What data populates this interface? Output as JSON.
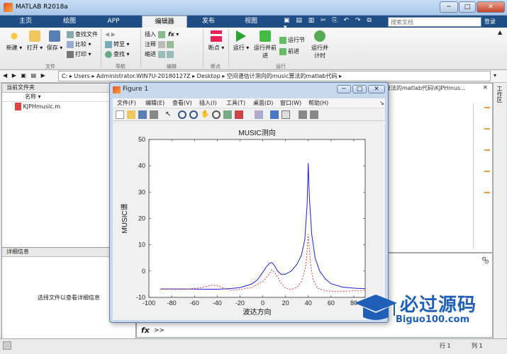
{
  "window": {
    "title": "MATLAB R2018a",
    "min": "─",
    "max": "□",
    "close": "✕"
  },
  "tabs": [
    {
      "label": "主页"
    },
    {
      "label": "绘图"
    },
    {
      "label": "APP"
    },
    {
      "label": "编辑器"
    },
    {
      "label": "发布"
    },
    {
      "label": "视图"
    }
  ],
  "search": {
    "placeholder": "搜索文档",
    "login": "登录"
  },
  "ribbon": {
    "file": {
      "new": "新建",
      "open": "打开",
      "save": "保存",
      "find_files": "查找文件",
      "compare": "比较",
      "print": "打印",
      "group": "文件"
    },
    "nav": {
      "goto": "转至",
      "find": "查找",
      "group": "导航"
    },
    "edit": {
      "insert": "插入",
      "comment": "注释",
      "indent": "缩进",
      "fx": "fx",
      "group": "编辑"
    },
    "breakpoints": {
      "label": "断点",
      "group": "断点"
    },
    "run": {
      "run": "运行",
      "run_advance": "运行并前进",
      "run_section": "运行节",
      "advance": "前进",
      "run_time": "运行并计时",
      "group": "运行"
    }
  },
  "address": {
    "path": [
      "C:",
      "Users",
      "Administrator.WIN7U-20180127Z",
      "Desktop",
      "空间谱估计测向的music算法的matlab代码"
    ]
  },
  "current_folder": {
    "title": "当前文件夹",
    "col_name": "名称 ▾",
    "files": [
      {
        "name": "KJPHmusic.m"
      }
    ]
  },
  "details": {
    "title": "详细信息",
    "hint": "选择文件以查看详细信息"
  },
  "editor": {
    "tab_text": "算法的matlab代码\\KJPHmus..."
  },
  "workspace": {
    "label": "工作区"
  },
  "command": {
    "prompt": ">>"
  },
  "status": {
    "row_label": "行",
    "row": "1",
    "col_label": "列",
    "col": "1"
  },
  "figure": {
    "title": "Figure 1",
    "menu": [
      "文件(F)",
      "编辑(E)",
      "查看(V)",
      "插入(I)",
      "工具(T)",
      "桌面(D)",
      "窗口(W)",
      "帮助(H)"
    ]
  },
  "chart_data": {
    "type": "line",
    "title": "MUSIC测向",
    "xlabel": "波达方向",
    "ylabel": "MUSIC谱",
    "xlim": [
      -100,
      90
    ],
    "ylim": [
      -10,
      50
    ],
    "xticks": [
      -100,
      -80,
      -60,
      -40,
      -20,
      0,
      20,
      40,
      60,
      80
    ],
    "yticks": [
      -10,
      0,
      10,
      20,
      30,
      40,
      50
    ],
    "grid": false,
    "series": [
      {
        "color": "#1f1fd8",
        "style": "solid",
        "x": [
          -90,
          -70,
          -50,
          -40,
          -30,
          -20,
          -10,
          -5,
          0,
          3,
          6,
          8,
          10,
          13,
          16,
          20,
          25,
          30,
          34,
          37,
          39,
          40,
          41,
          43,
          46,
          50,
          55,
          60,
          70,
          80,
          90
        ],
        "y": [
          -6.8,
          -6.8,
          -6.9,
          -6.9,
          -6.7,
          -6.3,
          -5,
          -3.5,
          -0.5,
          1.5,
          3,
          3.2,
          2.3,
          0,
          -1.2,
          -1.2,
          0,
          2.5,
          6,
          12,
          25,
          41,
          28,
          14,
          5,
          0,
          -3,
          -4.8,
          -6.1,
          -6.5,
          -6.7
        ]
      },
      {
        "color": "#e04040",
        "style": "dashed",
        "x": [
          -90,
          -70,
          -55,
          -45,
          -40,
          -35,
          -28,
          -20,
          -10,
          0,
          5,
          8,
          12,
          16,
          20,
          25,
          30,
          34,
          38,
          40,
          42,
          44,
          48,
          55,
          65,
          75,
          90
        ],
        "y": [
          -6.9,
          -7,
          -6.4,
          -5.4,
          -5.5,
          -6.4,
          -7.3,
          -7,
          -6.3,
          -4,
          -1.5,
          0.5,
          -1.5,
          -4.5,
          -6.5,
          -7,
          -6.2,
          -4,
          2,
          14,
          3,
          -3,
          -6.5,
          -7.5,
          -7.8,
          -7.6,
          -7.3
        ]
      }
    ]
  },
  "watermark": {
    "text": "必过源码",
    "url": "Biguo100.com"
  }
}
